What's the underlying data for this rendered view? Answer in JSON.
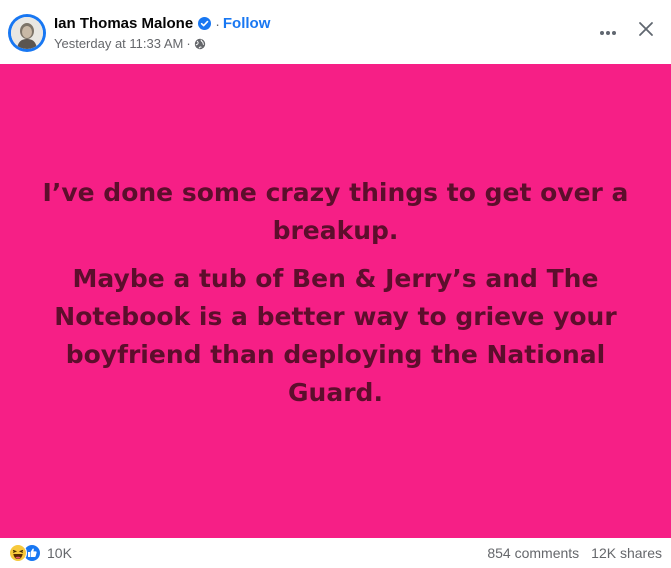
{
  "post": {
    "author": {
      "name": "Ian Thomas Malone",
      "verified": true,
      "follow_label": "Follow",
      "separator": "·"
    },
    "timestamp": "Yesterday at 11:33 AM",
    "timestamp_separator": "·",
    "audience_icon": "globe-icon",
    "background_color": "#f61f86",
    "text_color": "#5c0e2c",
    "text_paragraphs": [
      "I’ve done some crazy things to get over a breakup.",
      "Maybe a tub of Ben & Jerry’s and The Notebook is a better way to grieve your boyfriend than deploying the National Guard."
    ]
  },
  "header_actions": {
    "more_icon": "more-options-icon",
    "close_icon": "close-icon"
  },
  "footer": {
    "reaction_icons": [
      "haha-reaction-icon",
      "like-reaction-icon"
    ],
    "reaction_count": "10K",
    "comments": "854 comments",
    "shares": "12K shares"
  },
  "colors": {
    "brand_blue": "#1877f2",
    "secondary_text": "#65676b"
  }
}
